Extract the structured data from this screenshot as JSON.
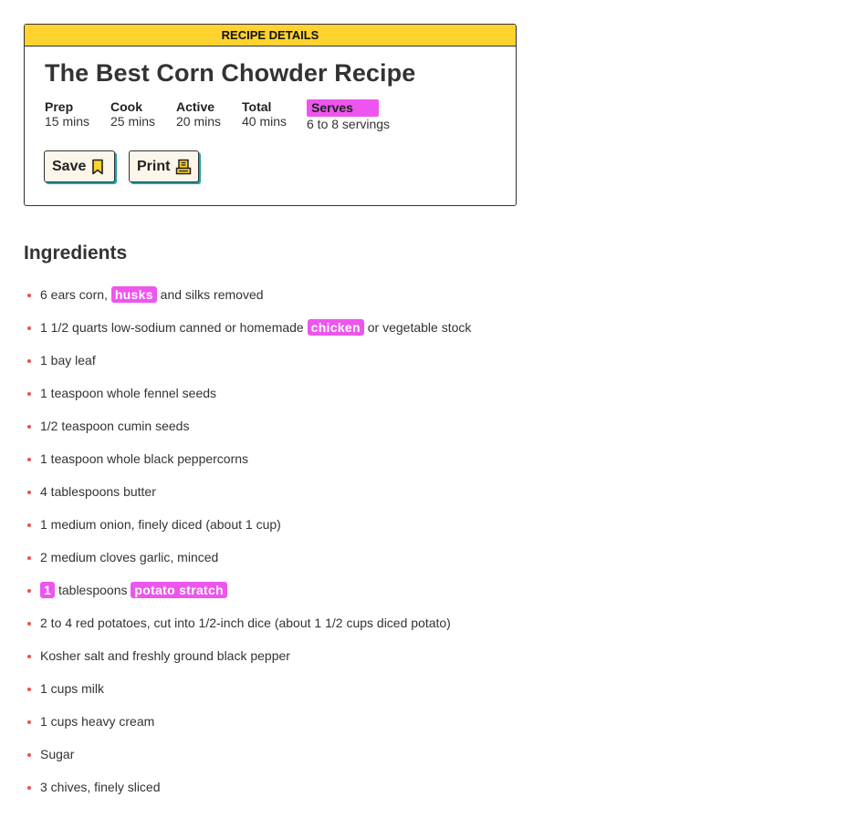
{
  "card": {
    "header": "RECIPE DETAILS",
    "title": "The Best Corn Chowder Recipe",
    "meta": [
      {
        "label": "Prep",
        "value": "15 mins"
      },
      {
        "label": "Cook",
        "value": "25 mins"
      },
      {
        "label": "Active",
        "value": "20 mins"
      },
      {
        "label": "Total",
        "value": "40 mins"
      }
    ],
    "serves": {
      "label": "Serves",
      "value": "6 to 8 servings"
    },
    "save_label": "Save",
    "print_label": "Print",
    "save_icon": "bookmark-icon",
    "print_icon": "printer-icon",
    "colors": {
      "header_bg": "#ffd22e",
      "highlight": "#ee55ee",
      "button_shadow": "#1aa3ad",
      "bullet": "#e8534a"
    }
  },
  "ingredients": {
    "title": "Ingredients",
    "items": [
      {
        "parts": [
          {
            "text": "6 ears corn, "
          },
          {
            "text": "husks",
            "hl": true
          },
          {
            "text": " and silks removed"
          }
        ]
      },
      {
        "parts": [
          {
            "text": "1 1/2 quarts low-sodium canned or homemade "
          },
          {
            "text": "chicken",
            "hl": true
          },
          {
            "text": " or vegetable stock"
          }
        ]
      },
      {
        "parts": [
          {
            "text": "1 bay leaf"
          }
        ]
      },
      {
        "parts": [
          {
            "text": "1 teaspoon whole fennel seeds"
          }
        ]
      },
      {
        "parts": [
          {
            "text": "1/2 teaspoon cumin seeds"
          }
        ]
      },
      {
        "parts": [
          {
            "text": "1 teaspoon whole black peppercorns"
          }
        ]
      },
      {
        "parts": [
          {
            "text": "4 tablespoons butter"
          }
        ]
      },
      {
        "parts": [
          {
            "text": "1 medium onion, finely diced (about 1 cup)"
          }
        ]
      },
      {
        "parts": [
          {
            "text": "2 medium cloves garlic, minced"
          }
        ]
      },
      {
        "parts": [
          {
            "text": "1",
            "hl": true
          },
          {
            "text": " tablespoons "
          },
          {
            "text": "potato stratch",
            "hl": true
          }
        ]
      },
      {
        "parts": [
          {
            "text": "2 to 4 red potatoes, cut into 1/2-inch dice (about 1 1/2 cups diced potato)"
          }
        ]
      },
      {
        "parts": [
          {
            "text": "Kosher salt and freshly ground black pepper"
          }
        ]
      },
      {
        "parts": [
          {
            "text": "1 cups milk"
          }
        ]
      },
      {
        "parts": [
          {
            "text": "1 cups heavy cream"
          }
        ]
      },
      {
        "parts": [
          {
            "text": "Sugar"
          }
        ]
      },
      {
        "parts": [
          {
            "text": "3 chives, finely sliced"
          }
        ]
      }
    ]
  }
}
